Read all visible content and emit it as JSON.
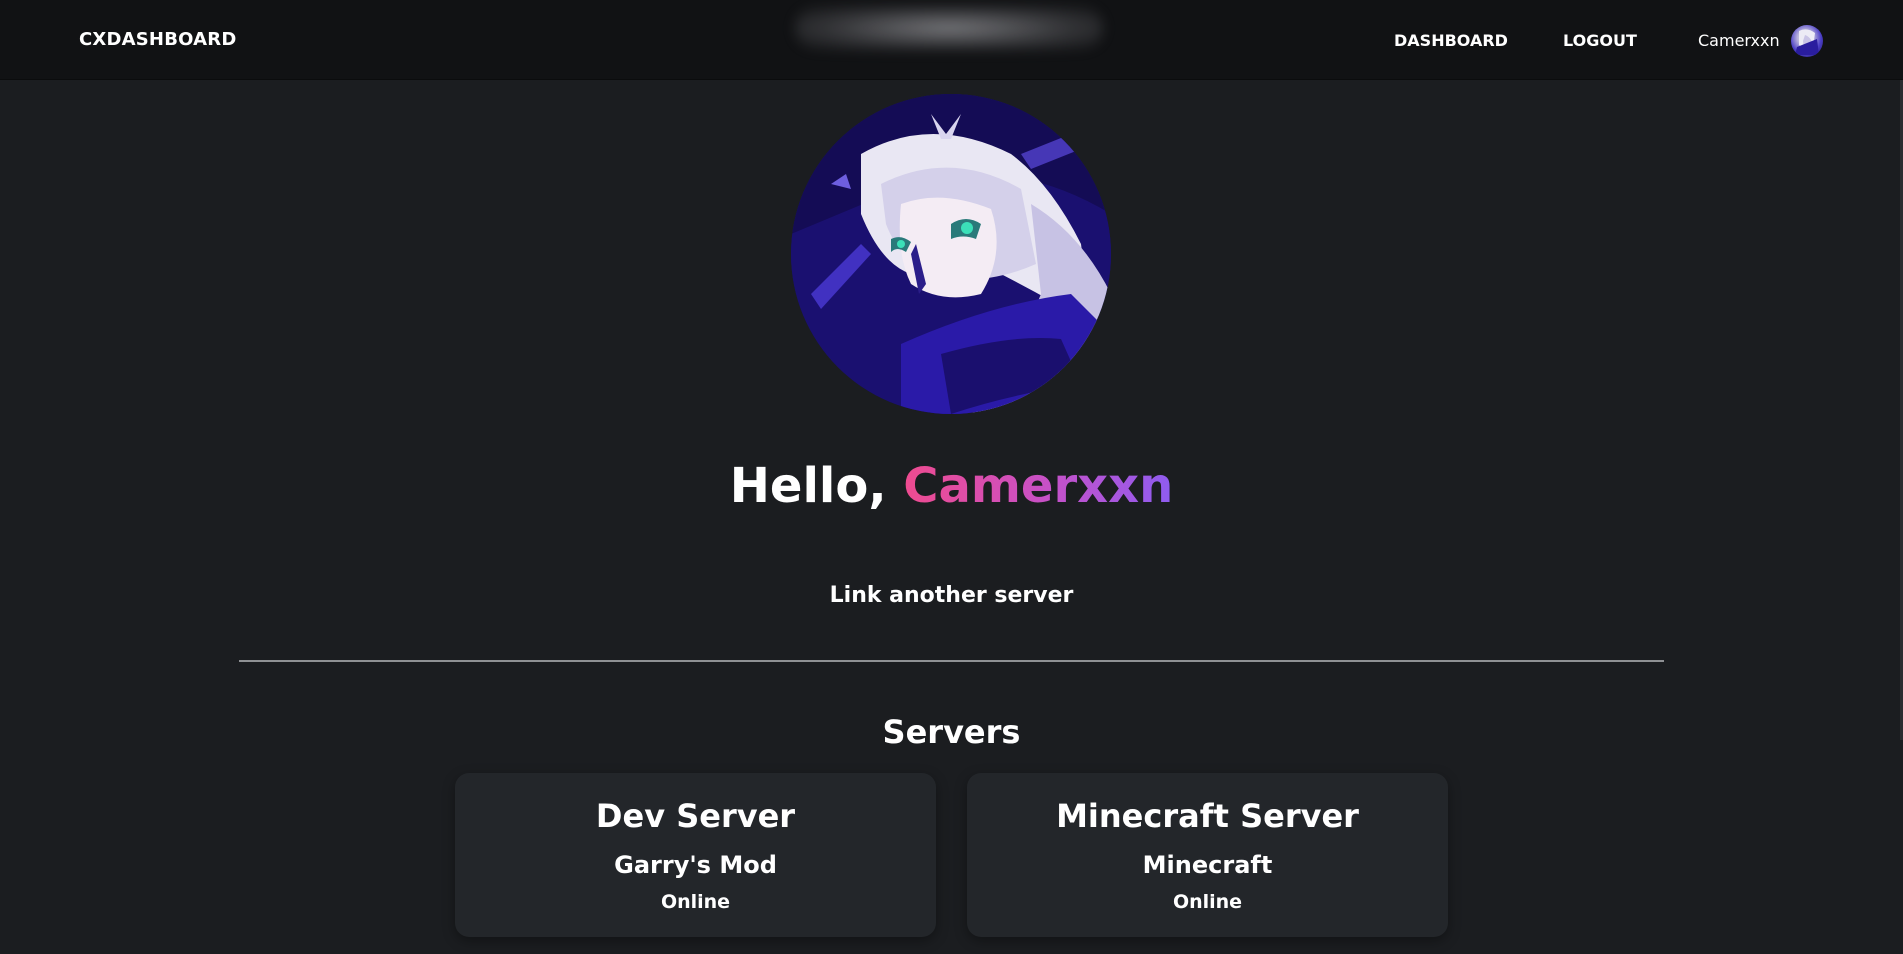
{
  "navbar": {
    "brand": "CXDASHBOARD",
    "links": [
      {
        "label": "DASHBOARD"
      },
      {
        "label": "LOGOUT"
      }
    ],
    "username": "Camerxxn"
  },
  "profile": {
    "greeting_prefix": "Hello,",
    "username": "Camerxxn",
    "gradient_colors": [
      "#ef4b8f",
      "#8e5cf0"
    ]
  },
  "actions": {
    "link_server": "Link another server"
  },
  "servers": {
    "heading": "Servers",
    "items": [
      {
        "name": "Dev Server",
        "game": "Garry's Mod",
        "status": "Online"
      },
      {
        "name": "Minecraft Server",
        "game": "Minecraft",
        "status": "Online"
      }
    ]
  }
}
